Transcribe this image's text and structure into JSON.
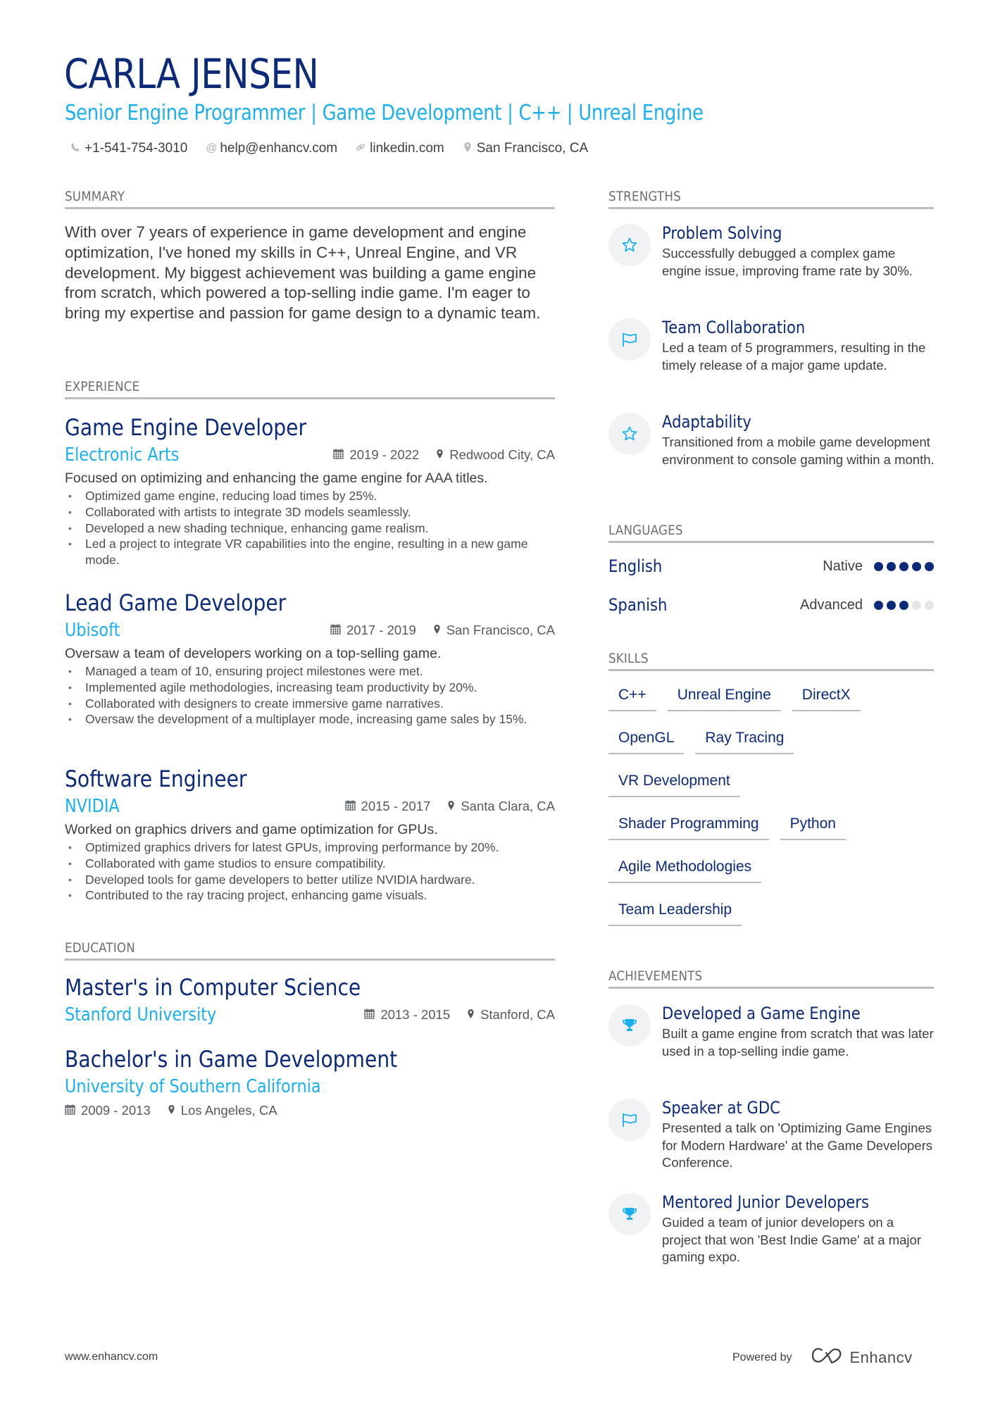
{
  "header": {
    "name": "CARLA JENSEN",
    "subtitle": "Senior Engine Programmer | Game Development | C++ | Unreal Engine",
    "contacts": [
      {
        "icon": "phone-icon",
        "text": "+1-541-754-3010"
      },
      {
        "icon": "at-icon",
        "text": "help@enhancv.com"
      },
      {
        "icon": "link-icon",
        "text": "linkedin.com"
      },
      {
        "icon": "location-pin-icon",
        "text": "San Francisco, CA"
      }
    ]
  },
  "summary": {
    "heading": "Summary",
    "text": "With over 7 years of experience in game development and engine optimization, I've honed my skills in C++, Unreal Engine, and VR development. My biggest achievement was building a game engine from scratch, which powered a top-selling indie game. I'm eager to bring my expertise and passion for game design to a dynamic team."
  },
  "experience": {
    "heading": "Experience",
    "jobs": [
      {
        "title": "Game Engine Developer",
        "company": "Electronic Arts",
        "dates": "2019 - 2022",
        "location": "Redwood City, CA",
        "description": "Focused on optimizing and enhancing the game engine for AAA titles.",
        "bullets": [
          "Optimized game engine, reducing load times by 25%.",
          "Collaborated with artists to integrate 3D models seamlessly.",
          "Developed a new shading technique, enhancing game realism.",
          "Led a project to integrate VR capabilities into the engine, resulting in a new game mode."
        ]
      },
      {
        "title": "Lead Game Developer",
        "company": "Ubisoft",
        "dates": "2017 - 2019",
        "location": "San Francisco, CA",
        "description": "Oversaw a team of developers working on a top-selling game.",
        "bullets": [
          "Managed a team of 10, ensuring project milestones were met.",
          "Implemented agile methodologies, increasing team productivity by 20%.",
          "Collaborated with designers to create immersive game narratives.",
          "Oversaw the development of a multiplayer mode, increasing game sales by 15%."
        ]
      },
      {
        "title": "Software Engineer",
        "company": "NVIDIA",
        "dates": "2015 - 2017",
        "location": "Santa Clara, CA",
        "description": "Worked on graphics drivers and game optimization for GPUs.",
        "bullets": [
          "Optimized graphics drivers for latest GPUs, improving performance by 20%.",
          "Collaborated with game studios to ensure compatibility.",
          "Developed tools for game developers to better utilize NVIDIA hardware.",
          "Contributed to the ray tracing project, enhancing game visuals."
        ]
      }
    ]
  },
  "education": {
    "heading": "Education",
    "items": [
      {
        "degree": "Master's in Computer Science",
        "school": "Stanford University",
        "dates": "2013 - 2015",
        "location": "Stanford, CA"
      },
      {
        "degree": "Bachelor's in Game Development",
        "school": "University of Southern California",
        "dates": "2009 - 2013",
        "location": "Los Angeles, CA"
      }
    ]
  },
  "strengths": {
    "heading": "Strengths",
    "items": [
      {
        "icon": "star-icon",
        "title": "Problem Solving",
        "description": "Successfully debugged a complex game engine issue, improving frame rate by 30%."
      },
      {
        "icon": "flag-icon",
        "title": "Team Collaboration",
        "description": "Led a team of 5 programmers, resulting in the timely release of a major game update."
      },
      {
        "icon": "star-icon",
        "title": "Adaptability",
        "description": "Transitioned from a mobile game development environment to console gaming within a month."
      }
    ]
  },
  "languages": {
    "heading": "Languages",
    "items": [
      {
        "name": "English",
        "level": "Native",
        "rating": 5,
        "max": 5
      },
      {
        "name": "Spanish",
        "level": "Advanced",
        "rating": 3,
        "max": 5
      }
    ]
  },
  "skills": {
    "heading": "Skills",
    "items": [
      "C++",
      "Unreal Engine",
      "DirectX",
      "OpenGL",
      "Ray Tracing",
      "VR Development",
      "Shader Programming",
      "Python",
      "Agile Methodologies",
      "Team Leadership"
    ]
  },
  "achievements": {
    "heading": "Achievements",
    "items": [
      {
        "icon": "trophy-icon",
        "title": "Developed a Game Engine",
        "description": "Built a game engine from scratch that was later used in a top-selling indie game."
      },
      {
        "icon": "flag-icon",
        "title": "Speaker at GDC",
        "description": "Presented a talk on 'Optimizing Game Engines for Modern Hardware' at the Game Developers Conference."
      },
      {
        "icon": "trophy-icon",
        "title": "Mentored Junior Developers",
        "description": "Guided a team of junior developers on a project that won 'Best Indie Game' at a major gaming expo."
      }
    ]
  },
  "footer": {
    "website": "www.enhancv.com",
    "powered_by": "Powered by",
    "brand": "Enhancv"
  },
  "colors": {
    "primary": "#0b2a7a",
    "accent": "#1ab0ef",
    "rule": "#b9bcc0",
    "icon_bg": "#f1f2f3"
  }
}
